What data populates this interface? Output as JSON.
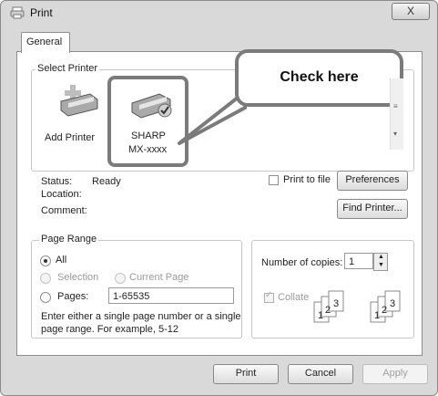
{
  "window": {
    "title": "Print",
    "close_label": "X"
  },
  "tabs": [
    {
      "label": "General"
    }
  ],
  "select_printer": {
    "label": "Select Printer",
    "printers": [
      {
        "name": "Add Printer"
      },
      {
        "name": "SHARP\nMX-xxxx",
        "line1": "SHARP",
        "line2": "MX-xxxx"
      }
    ],
    "status_label": "Status:",
    "status_value": "Ready",
    "location_label": "Location:",
    "comment_label": "Comment:",
    "print_to_file": "Print to file",
    "preferences": "Preferences",
    "find_printer": "Find Printer..."
  },
  "callout": {
    "text": "Check here"
  },
  "page_range": {
    "label": "Page Range",
    "all": "All",
    "selection": "Selection",
    "current_page": "Current Page",
    "pages": "Pages:",
    "pages_value": "1-65535",
    "help": "Enter either a single page number or a single",
    "help2": "page range.  For example, 5-12",
    "selected": "All"
  },
  "copies": {
    "label": "Number of copies:",
    "value": "1",
    "collate": "Collate",
    "collate_checked": true
  },
  "buttons": {
    "print": "Print",
    "cancel": "Cancel",
    "apply": "Apply"
  }
}
